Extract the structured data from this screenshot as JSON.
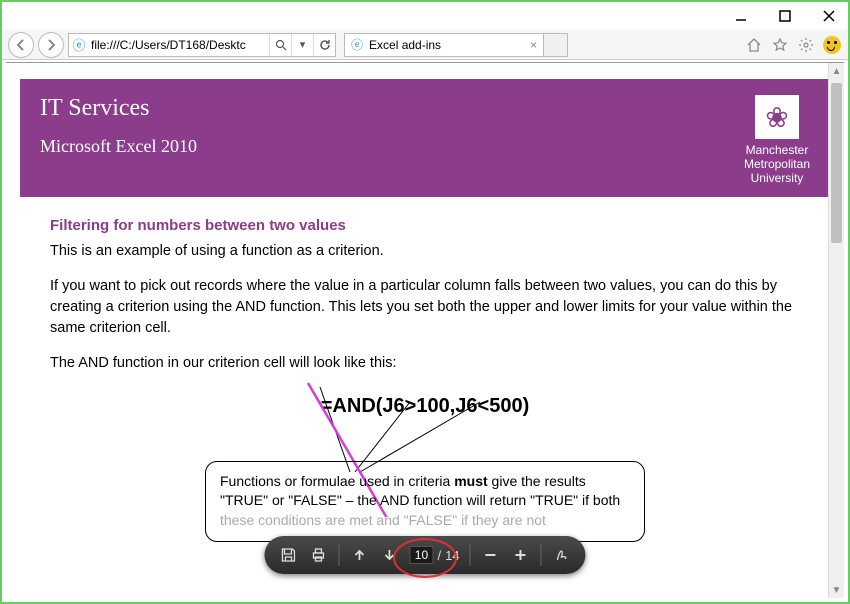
{
  "window": {
    "address": "file:///C:/Users/DT168/Desktc",
    "tab_title": "Excel add-ins"
  },
  "doc": {
    "header_title": "IT Services",
    "header_subtitle": "Microsoft Excel 2010",
    "university_line1": "Manchester",
    "university_line2": "Metropolitan",
    "university_line3": "University",
    "section_heading": "Filtering for numbers between two values",
    "p1": "This is an example of using a function as a criterion.",
    "p2": "If you want to pick out records where the value in a particular column falls between two values, you can do this by creating a criterion using the AND function.  This lets you set both the upper and lower limits for your value within the same criterion cell.",
    "p3": "The AND function in our criterion cell will look like this:",
    "formula": "=AND(J6>100,J6<500)",
    "callout_1a": "Functions or formulae used in criteria ",
    "callout_must": "must",
    "callout_1b": " give the results \"TRUE\" or \"FALSE\" – the AND function will return \"TRUE\" if both ",
    "callout_cut": "these conditions are met and \"FALSE\" if they are not"
  },
  "pdf": {
    "current_page": "10",
    "total_pages": "14",
    "sep": "/"
  }
}
